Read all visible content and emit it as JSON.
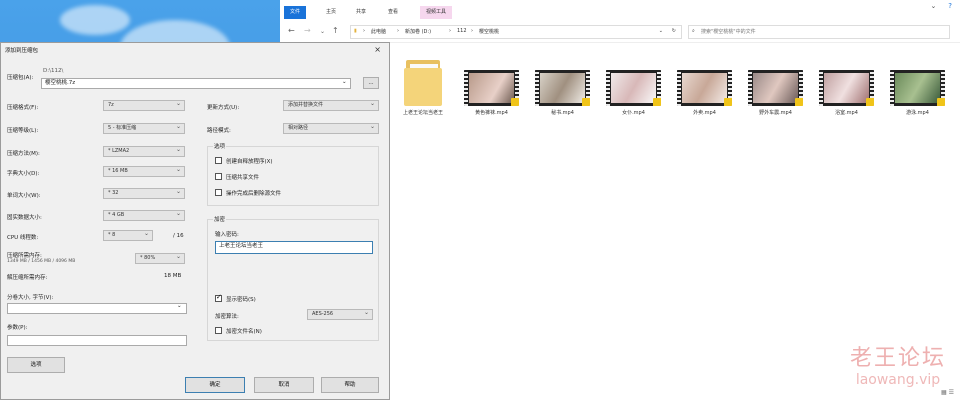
{
  "explorer": {
    "tabs": [
      "文件",
      "主页",
      "共享",
      "查看",
      "视频工具"
    ],
    "breadcrumb": [
      "此电脑",
      "新加卷 (D:)",
      "112",
      "樱空桃桃"
    ],
    "search_placeholder": "搜索\"樱空桃桃\"中的文件",
    "items": [
      {
        "name": "上老王论坛当老王",
        "type": "folder"
      },
      {
        "name": "黄色裤袜.mp4",
        "type": "video"
      },
      {
        "name": "秘书.mp4",
        "type": "video"
      },
      {
        "name": "女仆.mp4",
        "type": "video"
      },
      {
        "name": "外卖.mp4",
        "type": "video"
      },
      {
        "name": "野外车震.mp4",
        "type": "video"
      },
      {
        "name": "浴室.mp4",
        "type": "video"
      },
      {
        "name": "游泳.mp4",
        "type": "video"
      }
    ]
  },
  "dialog": {
    "title": "添加到压缩包",
    "archive_label": "压缩包(A):",
    "archive_path": "D:\\112\\",
    "archive_name": "樱空桃桃.7z",
    "browse_label": "...",
    "format_label": "压缩格式(F):",
    "format_value": "7z",
    "level_label": "压缩等级(L):",
    "level_value": "5 - 标准压缩",
    "method_label": "压缩方法(M):",
    "method_value": "* LZMA2",
    "dict_label": "字典大小(D):",
    "dict_value": "* 16 MB",
    "word_label": "单词大小(W):",
    "word_value": "* 32",
    "solid_label": "固实数据大小:",
    "solid_value": "* 4 GB",
    "cpu_label": "CPU 线程数:",
    "cpu_value": "* 8",
    "cpu_total": "/ 16",
    "mem_label": "压缩所需内存:",
    "mem_detail": "1349 MB / 1456 MB / 4096 MB",
    "mem_percent": "* 80%",
    "decomp_label": "解压缩所需内存:",
    "decomp_value": "18 MB",
    "split_label": "分卷大小, 字节(V):",
    "params_label": "参数(P):",
    "options_button": "选项",
    "update_label": "更新方式(U):",
    "update_value": "添加并替换文件",
    "path_label": "路径模式:",
    "path_value": "相对路径",
    "opts_group": "选项",
    "opt1": "创建自释放程序(X)",
    "opt2": "压缩共享文件",
    "opt3": "操作完成后删除源文件",
    "enc_group": "加密",
    "pwd_label": "输入密码:",
    "pwd_value": "上老王论坛当老王",
    "show_pwd": "显示密码(S)",
    "enc_method_label": "加密算法:",
    "enc_method_value": "AES-256",
    "enc_names": "加密文件名(N)",
    "ok": "确定",
    "cancel": "取消",
    "help": "帮助",
    "close_icon": "×"
  },
  "watermark": {
    "cn": "老王论坛",
    "en": "laowang.vip"
  }
}
